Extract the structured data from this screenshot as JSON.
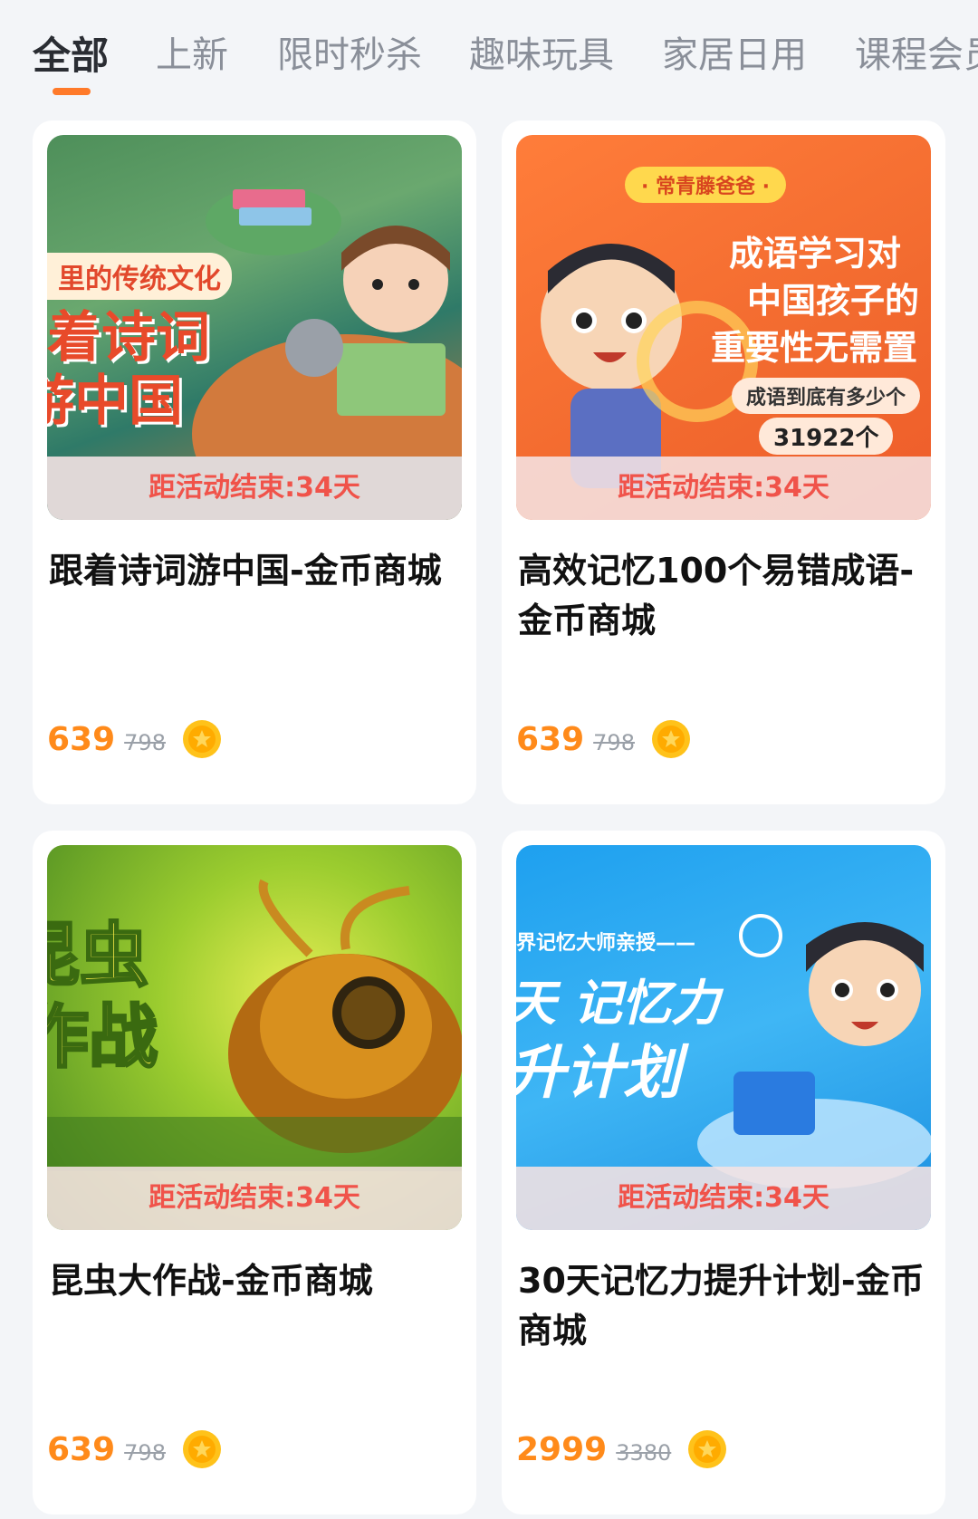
{
  "tabs": [
    "全部",
    "上新",
    "限时秒杀",
    "趣味玩具",
    "家居日用",
    "课程会员"
  ],
  "active_tab": "全部",
  "cards": [
    {
      "title": "跟着诗词游中国-金币商城",
      "countdown": "距活动结束:34天",
      "price": "639",
      "original_price": "798",
      "image": {
        "banner": "里的传统文化",
        "line1": "着诗词",
        "line2": "游中国"
      }
    },
    {
      "title": "高效记忆100个易错成语-金币商城",
      "countdown": "距活动结束:34天",
      "price": "639",
      "original_price": "798",
      "image": {
        "badge": "· 常青藤爸爸 ·",
        "line1": "成语学习对",
        "line2": "中国孩子的",
        "line3": "重要性无需置",
        "sub": "成语到底有多少个",
        "num": "31922个"
      }
    },
    {
      "title": "昆虫大作战-金币商城",
      "countdown": "距活动结束:34天",
      "price": "639",
      "original_price": "798",
      "image": {
        "line1": "昆虫",
        "line2": "作战"
      }
    },
    {
      "title": "30天记忆力提升计划-金币商城",
      "countdown": "距活动结束:34天",
      "price": "2999",
      "original_price": "3380",
      "image": {
        "top": "界记忆大师亲授——",
        "line1": "天 记忆力",
        "line2": "升计划"
      }
    }
  ],
  "colors": {
    "accent": "#ff7a2a",
    "price": "#ff8a1a",
    "countdown": "#f0534a"
  }
}
